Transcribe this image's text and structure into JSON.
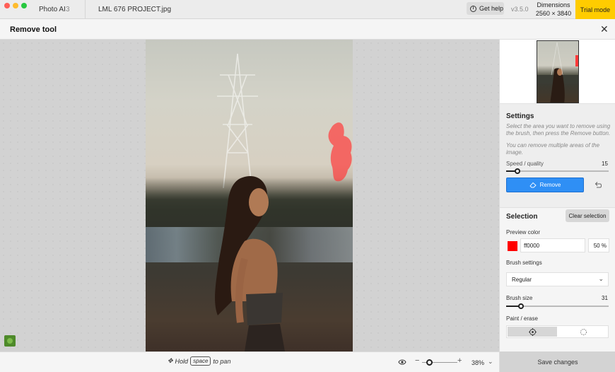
{
  "titlebar": {
    "app_name": "Photo AI",
    "app_version": "3",
    "filename": "LML 676 PROJECT.jpg",
    "get_help": "Get help",
    "version": "v3.5.0",
    "dimensions_label": "Dimensions",
    "dimensions_value": "2560 × 3840",
    "trial_mode": "Trial mode"
  },
  "tool": {
    "title": "Remove tool",
    "close_icon": "close-icon"
  },
  "bottombar": {
    "hold": "Hold",
    "key": "space",
    "to_pan": "to pan",
    "zoom_percent": "38%",
    "zoom_level": 0.2
  },
  "settings": {
    "title": "Settings",
    "description_1": "Select the area you want to remove using the brush, then press the Remove button.",
    "description_2": "You can remove multiple areas of the image.",
    "speed_quality_label": "Speed / quality",
    "speed_quality_value": "15",
    "remove_button": "Remove"
  },
  "selection": {
    "title": "Selection",
    "clear_button": "Clear selection",
    "preview_color_label": "Preview color",
    "preview_color_hex": "ff0000",
    "preview_color": "#ff0000",
    "preview_opacity": "50",
    "preview_opacity_unit": "%",
    "brush_settings_label": "Brush settings",
    "brush_mode": "Regular",
    "brush_size_label": "Brush size",
    "brush_size_value": "31",
    "paint_erase_label": "Paint / erase",
    "active_mode": "paint"
  },
  "footer": {
    "save_button": "Save changes"
  },
  "colors": {
    "accent": "#2f8ff5",
    "trial": "#ffcc00"
  }
}
